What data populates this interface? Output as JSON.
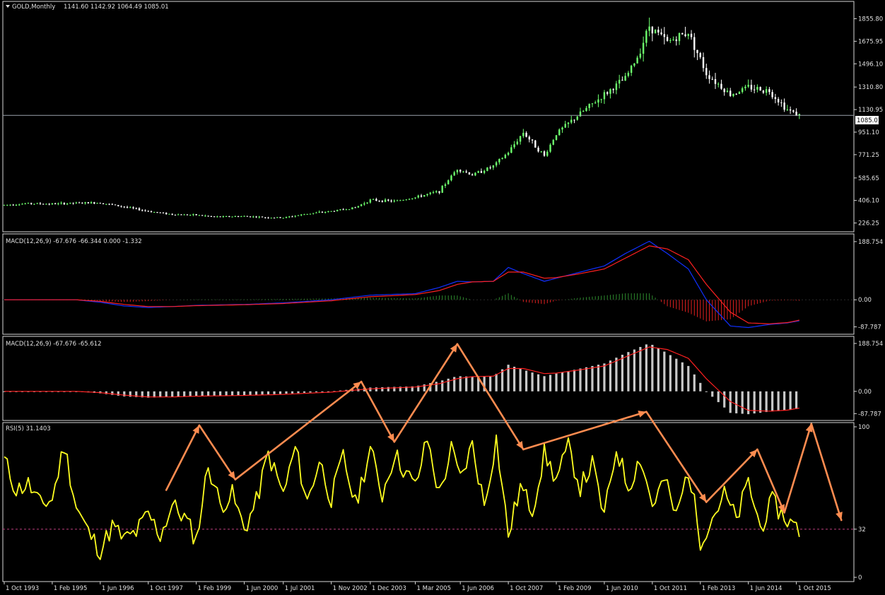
{
  "chart_data": [
    {
      "type": "candlestick",
      "panel": "price",
      "header": {
        "symbol": "GOLD,Monthly",
        "ohlc": "1141.60 1142.92 1064.49 1085.01"
      },
      "ylim": [
        190,
        1960
      ],
      "y_ticks": [
        "1855.80",
        "1675.95",
        "1496.10",
        "1310.80",
        "1130.95",
        "951.10",
        "771.25",
        "585.65",
        "406.10",
        "226.25"
      ],
      "current_price_label": "1085.01",
      "current_price": 1085.01,
      "colors": {
        "bull": "#6dff6d",
        "bear": "#ffffff",
        "price_line": "#9aa0aa"
      },
      "series": [
        {
          "name": "close",
          "x": [
            "1993-10",
            "1994-06",
            "1995-02",
            "1995-10",
            "1996-06",
            "1997-02",
            "1997-10",
            "1998-06",
            "1999-02",
            "1999-08",
            "2000-06",
            "2001-02",
            "2001-07",
            "2002-03",
            "2002-11",
            "2003-07",
            "2003-12",
            "2004-08",
            "2005-03",
            "2005-11",
            "2006-05",
            "2006-10",
            "2007-05",
            "2007-10",
            "2008-03",
            "2008-10",
            "2009-02",
            "2009-10",
            "2010-06",
            "2011-01",
            "2011-05",
            "2011-09",
            "2012-03",
            "2012-10",
            "2013-04",
            "2013-12",
            "2014-06",
            "2015-01",
            "2015-07",
            "2015-11"
          ],
          "values": [
            370,
            382,
            378,
            385,
            388,
            355,
            320,
            295,
            290,
            275,
            280,
            270,
            268,
            300,
            320,
            350,
            410,
            400,
            430,
            480,
            660,
            610,
            680,
            790,
            950,
            760,
            940,
            1100,
            1250,
            1380,
            1550,
            1800,
            1670,
            1750,
            1420,
            1250,
            1310,
            1280,
            1130,
            1085
          ]
        }
      ]
    },
    {
      "type": "line+histogram",
      "panel": "macd1",
      "header": "MACD(12,26,9) -67.676 -66.344 0.000 -1.332",
      "ylim": [
        -98,
        200
      ],
      "y_ticks": [
        "188.754",
        "0.00",
        "-87.787"
      ],
      "y_tick_values": [
        188.754,
        0,
        -87.787
      ],
      "colors": {
        "macd": "#1030ff",
        "signal": "#ff2020",
        "hist_pos": "#2e8b2e",
        "hist_neg": "#e02020"
      },
      "series": [
        {
          "name": "macd",
          "x": [
            "1993-10",
            "1995-02",
            "1995-10",
            "1996-06",
            "1997-02",
            "1997-10",
            "1998-06",
            "1999-02",
            "2000-06",
            "2001-07",
            "2002-11",
            "2003-12",
            "2005-03",
            "2005-11",
            "2006-05",
            "2006-10",
            "2007-05",
            "2007-10",
            "2008-03",
            "2008-10",
            "2009-02",
            "2009-10",
            "2010-06",
            "2011-01",
            "2011-09",
            "2012-03",
            "2012-10",
            "2013-04",
            "2013-12",
            "2014-06",
            "2015-01",
            "2015-07",
            "2015-11"
          ],
          "values": [
            0,
            0,
            0,
            -8,
            -20,
            -25,
            -22,
            -18,
            -15,
            -10,
            0,
            15,
            20,
            40,
            60,
            58,
            60,
            105,
            85,
            60,
            70,
            90,
            110,
            150,
            190,
            150,
            100,
            0,
            -85,
            -90,
            -80,
            -75,
            -68
          ]
        },
        {
          "name": "signal",
          "x": [
            "1993-10",
            "1995-02",
            "1995-10",
            "1996-06",
            "1997-02",
            "1997-10",
            "1998-06",
            "1999-02",
            "2000-06",
            "2001-07",
            "2002-11",
            "2003-12",
            "2005-03",
            "2005-11",
            "2006-05",
            "2006-10",
            "2007-05",
            "2007-10",
            "2008-03",
            "2008-10",
            "2009-02",
            "2009-10",
            "2010-06",
            "2011-01",
            "2011-09",
            "2012-03",
            "2012-10",
            "2013-04",
            "2013-12",
            "2014-06",
            "2015-01",
            "2015-07",
            "2015-11"
          ],
          "values": [
            0,
            0,
            0,
            -5,
            -15,
            -22,
            -22,
            -19,
            -16,
            -12,
            -3,
            10,
            17,
            30,
            50,
            58,
            60,
            90,
            90,
            70,
            72,
            85,
            100,
            135,
            175,
            165,
            130,
            50,
            -40,
            -75,
            -78,
            -74,
            -66
          ]
        }
      ]
    },
    {
      "type": "line+histogram",
      "panel": "macd2",
      "header": "MACD(12,26,9) -67.676 -65.612",
      "ylim": [
        -98,
        200
      ],
      "y_ticks": [
        "188.754",
        "0.00",
        "-87.787"
      ],
      "y_tick_values": [
        188.754,
        0,
        -87.787
      ],
      "colors": {
        "hist": "#c8c8c8",
        "signal": "#ff2020"
      }
    },
    {
      "type": "line",
      "panel": "rsi",
      "header": "RSI(5) 31.1403",
      "ylim": [
        0,
        100
      ],
      "y_ticks": [
        "100",
        "32",
        "0"
      ],
      "level": 32,
      "colors": {
        "line": "#ffff20",
        "level": "#c04080",
        "arrows": "#ff8c50"
      },
      "series": [
        {
          "name": "RSI",
          "x": [
            "1993-10",
            "1994-02",
            "1994-06",
            "1994-10",
            "1995-02",
            "1995-06",
            "1995-10",
            "1996-02",
            "1996-06",
            "1996-10",
            "1997-02",
            "1997-06",
            "1997-10",
            "1998-02",
            "1998-06",
            "1998-10",
            "1999-02",
            "1999-06",
            "1999-10",
            "2000-02",
            "2000-06",
            "2000-10",
            "2001-02",
            "2001-07",
            "2001-11",
            "2002-03",
            "2002-07",
            "2002-11",
            "2003-03",
            "2003-07",
            "2003-12",
            "2004-04",
            "2004-08",
            "2005-03",
            "2005-07",
            "2005-11",
            "2006-03",
            "2006-06",
            "2006-10",
            "2007-02",
            "2007-06",
            "2007-10",
            "2008-02",
            "2008-06",
            "2008-10",
            "2009-02",
            "2009-06",
            "2009-10",
            "2010-02",
            "2010-06",
            "2010-10",
            "2011-02",
            "2011-06",
            "2011-10",
            "2012-02",
            "2012-06",
            "2012-10",
            "2013-02",
            "2013-06",
            "2013-10",
            "2014-02",
            "2014-06",
            "2014-10",
            "2015-02",
            "2015-06",
            "2015-11"
          ],
          "values": [
            78,
            58,
            62,
            48,
            52,
            88,
            47,
            30,
            18,
            34,
            25,
            30,
            42,
            28,
            48,
            40,
            25,
            75,
            48,
            55,
            32,
            50,
            82,
            55,
            86,
            50,
            78,
            52,
            80,
            48,
            85,
            55,
            82,
            60,
            92,
            55,
            85,
            65,
            88,
            48,
            92,
            28,
            60,
            45,
            82,
            65,
            86,
            60,
            75,
            40,
            86,
            60,
            80,
            48,
            65,
            40,
            72,
            25,
            40,
            55,
            38,
            63,
            33,
            50,
            40,
            31
          ]
        }
      ],
      "arrows": [
        [
          [
            "1998-04",
            58
          ],
          [
            "1999-03",
            101
          ]
        ],
        [
          [
            "1999-03",
            101
          ],
          [
            "2000-03",
            65
          ]
        ],
        [
          [
            "2000-03",
            65
          ],
          [
            "2003-09",
            130
          ]
        ],
        [
          [
            "2003-09",
            130
          ],
          [
            "2004-08",
            90
          ]
        ],
        [
          [
            "2004-08",
            90
          ],
          [
            "2006-05",
            155
          ]
        ],
        [
          [
            "2006-05",
            155
          ],
          [
            "2008-03",
            85
          ]
        ],
        [
          [
            "2008-03",
            85
          ],
          [
            "2011-08",
            110
          ]
        ],
        [
          [
            "2011-08",
            110
          ],
          [
            "2013-04",
            50
          ]
        ],
        [
          [
            "2013-04",
            50
          ],
          [
            "2014-09",
            85
          ]
        ],
        [
          [
            "2014-09",
            85
          ],
          [
            "2015-06",
            43
          ]
        ],
        [
          [
            "2015-06",
            43
          ],
          [
            "2016-03",
            102
          ]
        ],
        [
          [
            "2016-03",
            102
          ],
          [
            "2017-01",
            38
          ]
        ]
      ]
    }
  ],
  "x_axis": {
    "labels": [
      "1 Oct 1993",
      "1 Feb 1995",
      "1 Jun 1996",
      "1 Oct 1997",
      "1 Feb 1999",
      "1 Jun 2000",
      "1 Jul 2001",
      "1 Nov 2002",
      "1 Dec 2003",
      "1 Mar 2005",
      "1 Jun 2006",
      "1 Oct 2007",
      "1 Feb 2009",
      "1 Jun 2010",
      "1 Oct 2011",
      "1 Feb 2013",
      "1 Jun 2014",
      "1 Oct 2015"
    ],
    "dates": [
      "1993-10",
      "1995-02",
      "1996-06",
      "1997-10",
      "1999-02",
      "2000-06",
      "2001-07",
      "2002-11",
      "2003-12",
      "2005-03",
      "2006-06",
      "2007-10",
      "2009-02",
      "2010-06",
      "2011-10",
      "2013-02",
      "2014-06",
      "2015-10"
    ],
    "range": [
      "1993-10",
      "2017-04"
    ]
  }
}
